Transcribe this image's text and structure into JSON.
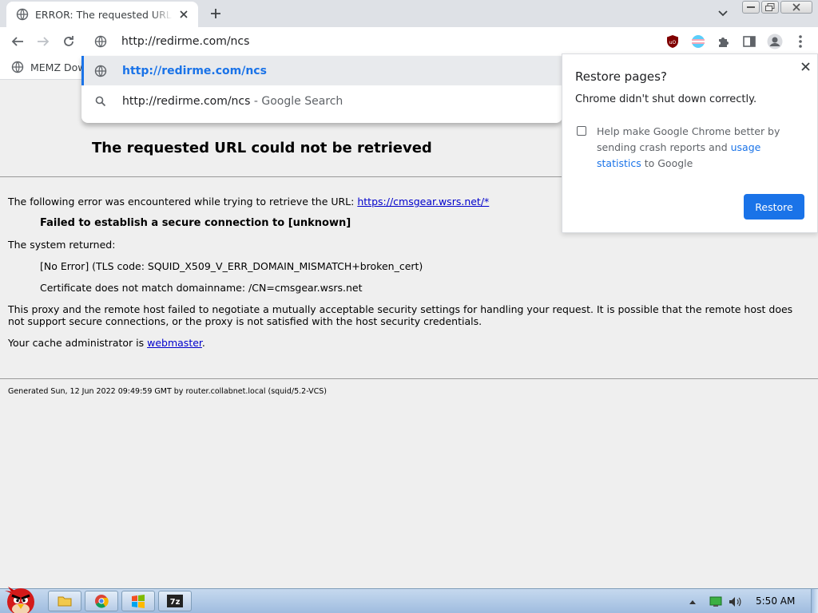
{
  "tab": {
    "title": "ERROR: The requested URL could not be retrieved"
  },
  "omnibox": {
    "value": "http://redirme.com/ncs"
  },
  "suggestions": [
    {
      "text": "http://redirme.com/ncs",
      "hint": ""
    },
    {
      "text": "http://redirme.com/ncs",
      "hint": " - Google Search"
    }
  ],
  "bookmarks": [
    {
      "label": "MEMZ Dow"
    }
  ],
  "page": {
    "heading": "The requested URL could not be retrieved",
    "intro": "The following error was encountered while trying to retrieve the URL: ",
    "url_link": "https://cmsgear.wsrs.net/*",
    "error": "Failed to establish a secure connection to [unknown]",
    "system_returned": "The system returned:",
    "tls": "[No Error] (TLS code: SQUID_X509_V_ERR_DOMAIN_MISMATCH+broken_cert)",
    "cert": "Certificate does not match domainname: /CN=cmsgear.wsrs.net",
    "explanation": "This proxy and the remote host failed to negotiate a mutually acceptable security settings for handling your request. It is possible that the remote host does not support secure connections, or the proxy is not satisfied with the host security credentials.",
    "admin_prefix": "Your cache administrator is ",
    "admin_link": "webmaster",
    "admin_suffix": ".",
    "footer": "Generated Sun, 12 Jun 2022 09:49:59 GMT by router.collabnet.local (squid/5.2-VCS)"
  },
  "restore_popup": {
    "title": "Restore pages?",
    "message": "Chrome didn't shut down correctly.",
    "checkbox_prefix": "Help make Google Chrome better by sending crash reports and ",
    "checkbox_link": "usage statistics",
    "checkbox_suffix": " to Google",
    "button": "Restore"
  },
  "taskbar": {
    "clock": "5:50 AM"
  },
  "colors": {
    "accent": "#1a73e8",
    "link": "#0000cc",
    "taskbar": "#9fbcdf"
  }
}
